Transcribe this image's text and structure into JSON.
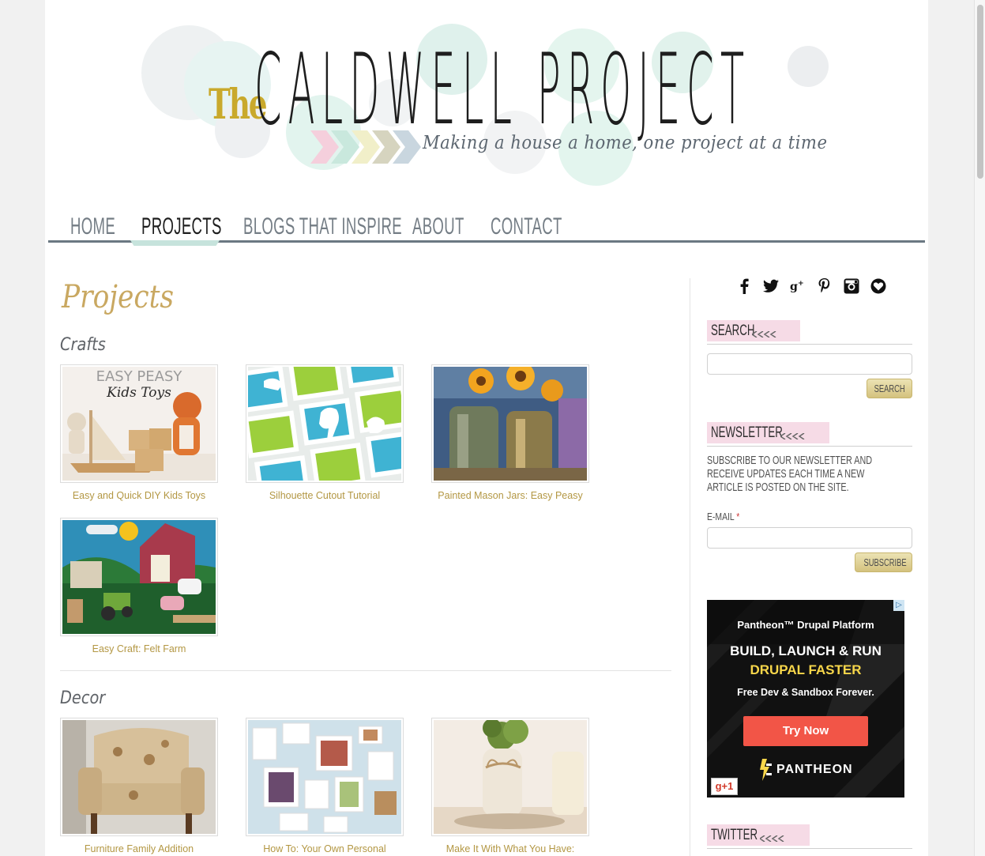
{
  "header": {
    "logo_the": "The",
    "logo_main": "CALDWELL PROJECT",
    "tagline": "Making a house a home, one project at a time"
  },
  "nav": {
    "items": [
      {
        "label": "HOME"
      },
      {
        "label": "PROJECTS"
      },
      {
        "label": "BLOGS THAT INSPIRE"
      },
      {
        "label": "ABOUT"
      },
      {
        "label": "CONTACT"
      }
    ],
    "active": "PROJECTS"
  },
  "main": {
    "title": "Projects",
    "sections": [
      {
        "heading": "Crafts",
        "items": [
          {
            "caption": "Easy and Quick DIY Kids Toys",
            "thumb_text": "EASY PEASY",
            "thumb_text2": "Kids Toys"
          },
          {
            "caption": "Silhouette Cutout Tutorial"
          },
          {
            "caption": "Painted Mason Jars: Easy Peasy"
          },
          {
            "caption": "Easy Craft: Felt Farm"
          }
        ]
      },
      {
        "heading": "Decor",
        "items": [
          {
            "caption": "Furniture Family Addition"
          },
          {
            "caption": "How To: Your Own Personal"
          },
          {
            "caption": "Make It With What You Have:"
          }
        ]
      }
    ]
  },
  "sidebar": {
    "social": [
      "facebook-icon",
      "twitter-icon",
      "google-plus-icon",
      "pinterest-icon",
      "instagram-icon",
      "bloglovin-icon"
    ],
    "search": {
      "title": "SEARCH",
      "button": "SEARCH",
      "placeholder": ""
    },
    "newsletter": {
      "title": "NEWSLETTER",
      "text": "Subscribe to our newsletter and receive updates each time a new article is posted on the site.",
      "email_label": "E-MAIL",
      "required_mark": "*",
      "button": "SUBSCRIBE"
    },
    "ad": {
      "line1": "Pantheon™ Drupal Platform",
      "line2": "BUILD, LAUNCH & RUN",
      "line3": "DRUPAL FASTER",
      "line4": "Free Dev & Sandbox Forever.",
      "cta": "Try Now",
      "brand": "PANTHEON",
      "gplus": "g+1",
      "adchoice": "▷"
    },
    "twitter": {
      "title": "TWITTER"
    }
  },
  "colors": {
    "accent_gold": "#c9a861",
    "caption_gold": "#b39743",
    "nav_gray": "#747d85",
    "nav_active_underline": "#c6e3dc",
    "widget_title_pink": "#f6dbe6",
    "ad_button": "#f25547"
  }
}
